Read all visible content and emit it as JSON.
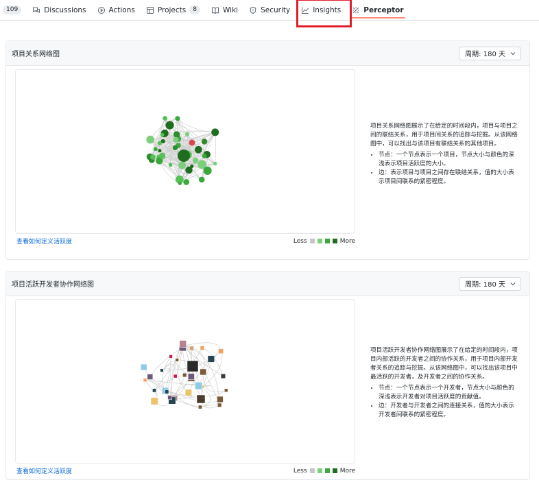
{
  "nav": {
    "items": [
      {
        "label": "109",
        "icon": "counter-partial"
      },
      {
        "label": "Discussions",
        "icon": "discussions-icon"
      },
      {
        "label": "Actions",
        "icon": "actions-icon"
      },
      {
        "label": "Projects",
        "icon": "projects-icon",
        "count": "8"
      },
      {
        "label": "Wiki",
        "icon": "wiki-icon"
      },
      {
        "label": "Security",
        "icon": "security-icon"
      },
      {
        "label": "Insights",
        "icon": "insights-icon"
      },
      {
        "label": "Perceptor",
        "icon": "perceptor-icon",
        "active": true
      }
    ]
  },
  "panels": [
    {
      "title": "项目关系网络图",
      "period": "周期: 180 天",
      "description": "项目关系网络图展示了在给定的时间段内，项目与项目之间的联结关系，用于项目间关系的追踪与挖掘。从该网络图中，可以找出与该项目有联结关系的其他项目。",
      "bullets": [
        "节点：一个节点表示一个项目，节点大小与颜色的深浅表示项目活跃度的大小。",
        "边：表示项目与项目之间存在联结关系，值的大小表示项目间联系的紧密程度。"
      ],
      "link": "查看如何定义活跃度",
      "legend_less": "Less",
      "legend_more": "More"
    },
    {
      "title": "项目活跃开发者协作网络图",
      "period": "周期: 180 天",
      "description": "项目活跃开发者协作网络图展示了在给定的时间段内，项目内部活跃的开发者之间的协作关系，用于项目内部开发者关系的追踪与挖掘。从该网络图中，可以找出该项目中最活跃的开发者，及开发者之间的协作关系。",
      "bullets": [
        "节点：一个节点表示一个开发者，节点大小与颜色的深浅表示开发者对项目活跃度的贡献值。",
        "边：开发者与开发者之间的连接关系，值的大小表示开发者间联系的紧密程度。"
      ],
      "link": "查看如何定义活跃度",
      "legend_less": "Less",
      "legend_more": "More"
    }
  ],
  "colors": {
    "legend": [
      "#c6c6c6",
      "#7ccf7c",
      "#3aa83a",
      "#1f6e1f"
    ],
    "highlight": "#e11d2a",
    "center_node": "#d9474b"
  }
}
